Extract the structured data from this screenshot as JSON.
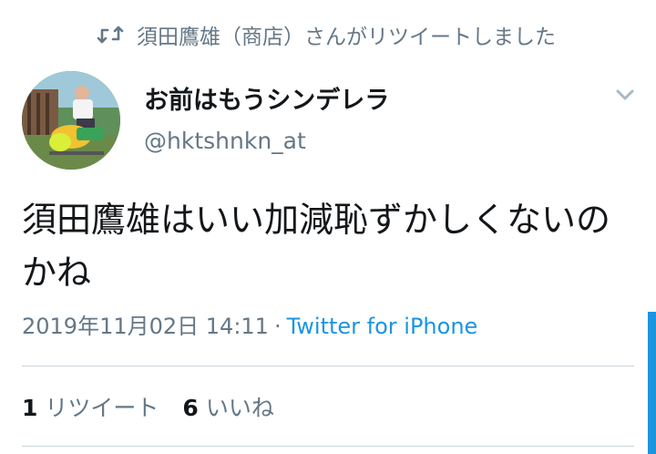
{
  "colors": {
    "text_primary": "#14171a",
    "text_secondary": "#657786",
    "link_blue": "#1b95e0",
    "divider": "#ccd6dd"
  },
  "retweet_context": {
    "icon": "retweet-icon",
    "text": "須田鷹雄（商店）さんがリツイートしました"
  },
  "author": {
    "display_name": "お前はもうシンデレラ",
    "handle": "@hktshnkn_at"
  },
  "tweet": {
    "text": "須田鷹雄はいい加減恥ずかしくないのかね",
    "timestamp": "2019年11月02日 14:11",
    "separator": "·",
    "source": "Twitter for iPhone"
  },
  "stats": {
    "retweet_count": "1",
    "retweet_label": "リツイート",
    "like_count": "6",
    "like_label": "いいね"
  }
}
